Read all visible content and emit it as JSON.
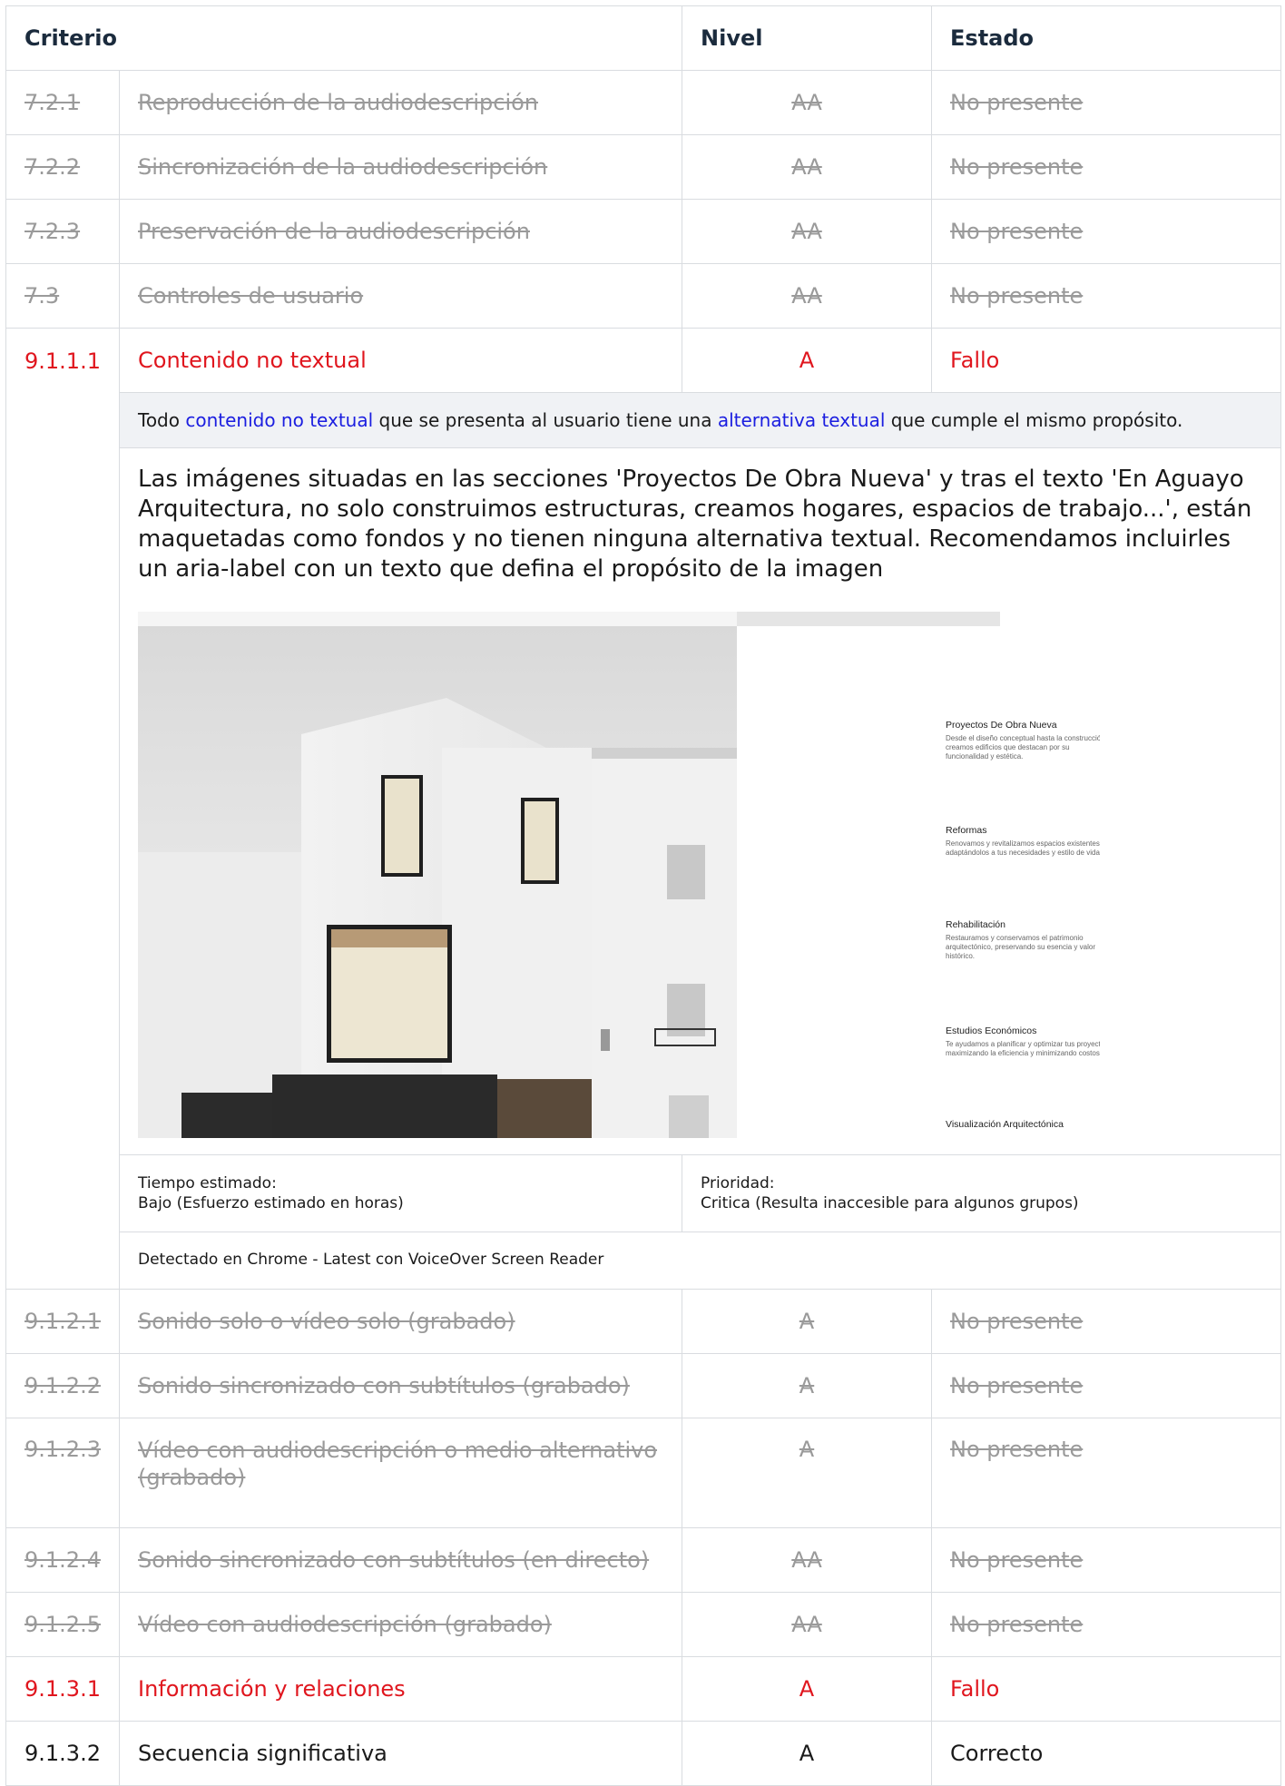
{
  "headers": {
    "criterio": "Criterio",
    "nivel": "Nivel",
    "estado": "Estado"
  },
  "rows_before": [
    {
      "code": "7.2.1",
      "name": "Reproducción de la audiodescripción",
      "level": "AA",
      "state": "No presente"
    },
    {
      "code": "7.2.2",
      "name": "Sincronización de la audiodescripción",
      "level": "AA",
      "state": "No presente"
    },
    {
      "code": "7.2.3",
      "name": "Preservación de la audiodescripción",
      "level": "AA",
      "state": "No presente"
    },
    {
      "code": "7.3",
      "name": "Controles de usuario",
      "level": "AA",
      "state": "No presente"
    }
  ],
  "failing": {
    "code": "9.1.1.1",
    "name": "Contenido no textual",
    "level": "A",
    "state": "Fallo",
    "definition": {
      "pre": "Todo ",
      "link1": "contenido no textual",
      "mid": " que se presenta al usuario tiene una ",
      "link2": "alternativa textual",
      "post": " que cumple el mismo propósito."
    },
    "description": "Las imágenes situadas en las secciones 'Proyectos De Obra Nueva' y tras el texto 'En Aguayo Arquitectura, no solo construimos estructuras, creamos hogares, espacios de trabajo...',  están maquetadas como fondos y no tienen ninguna alternativa textual. Recomendamos incluirles un aria-label con un texto que defina el propósito de la imagen",
    "screenshot": {
      "services": [
        {
          "title": "Proyectos De Obra Nueva",
          "text": "Desde el diseño conceptual hasta la construcción, creamos edificios que destacan por su funcionalidad y estética."
        },
        {
          "title": "Reformas",
          "text": "Renovamos y revitalizamos espacios existentes, adaptándolos a tus necesidades y estilo de vida."
        },
        {
          "title": "Rehabilitación",
          "text": "Restauramos y conservamos el patrimonio arquitectónico, preservando su esencia y valor histórico."
        },
        {
          "title": "Estudios Económicos",
          "text": "Te ayudamos a planificar y optimizar tus proyectos, maximizando la eficiencia y minimizando costos."
        },
        {
          "title": "Visualización Arquitectónica",
          "text": ""
        }
      ]
    },
    "time_label": "Tiempo estimado:",
    "time_value": "Bajo (Esfuerzo estimado en horas)",
    "priority_label": "Prioridad:",
    "priority_value": "Critica (Resulta inaccesible para algunos grupos)",
    "detected": "Detectado en Chrome - Latest con VoiceOver Screen Reader"
  },
  "rows_after": [
    {
      "code": "9.1.2.1",
      "name": "Sonido solo o vídeo solo (grabado)",
      "level": "A",
      "state": "No presente",
      "status": "na"
    },
    {
      "code": "9.1.2.2",
      "name": "Sonido sincronizado con subtítulos (grabado)",
      "level": "A",
      "state": "No presente",
      "status": "na"
    },
    {
      "code": "9.1.2.3",
      "name": "Vídeo con audiodescripción o medio alternativo (grabado)",
      "level": "A",
      "state": "No presente",
      "status": "na"
    },
    {
      "code": "9.1.2.4",
      "name": "Sonido sincronizado con subtítulos (en directo)",
      "level": "AA",
      "state": "No presente",
      "status": "na"
    },
    {
      "code": "9.1.2.5",
      "name": "Vídeo con audiodescripción (grabado)",
      "level": "AA",
      "state": "No presente",
      "status": "na"
    },
    {
      "code": "9.1.3.1",
      "name": "Información y relaciones",
      "level": "A",
      "state": "Fallo",
      "status": "fail"
    },
    {
      "code": "9.1.3.2",
      "name": "Secuencia significativa",
      "level": "A",
      "state": "Correcto",
      "status": "ok"
    }
  ]
}
